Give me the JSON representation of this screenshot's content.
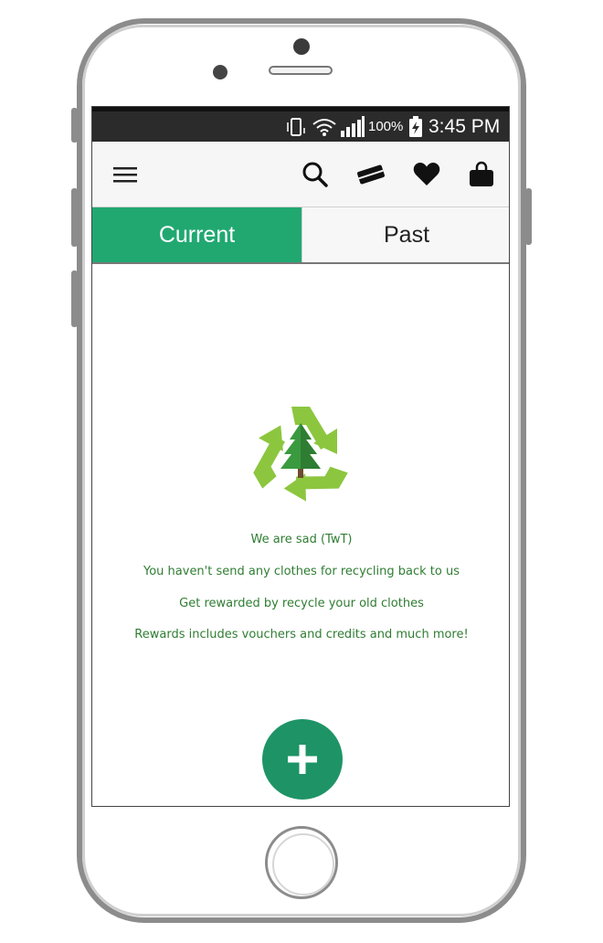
{
  "status_bar": {
    "battery_percent": "100%",
    "time": "3:45 PM"
  },
  "app_bar": {
    "icons": [
      "menu-icon",
      "search-icon",
      "voucher-card-icon",
      "heart-icon",
      "shopping-bag-icon"
    ]
  },
  "tabs": [
    {
      "label": "Current",
      "active": true
    },
    {
      "label": "Past",
      "active": false
    }
  ],
  "empty_state": {
    "icon": "recycle-tree-icon",
    "lines": [
      "We are sad (TwT)",
      "You haven't send any clothes for recycling back to us",
      "Get rewarded by recycle your old clothes",
      "Rewards includes vouchers and credits and much more!"
    ]
  },
  "fab": {
    "icon": "plus-icon"
  },
  "colors": {
    "accent": "#21a871",
    "fab": "#1e9466",
    "text_green": "#2f7d32",
    "status_bar": "#2b2b2b"
  }
}
